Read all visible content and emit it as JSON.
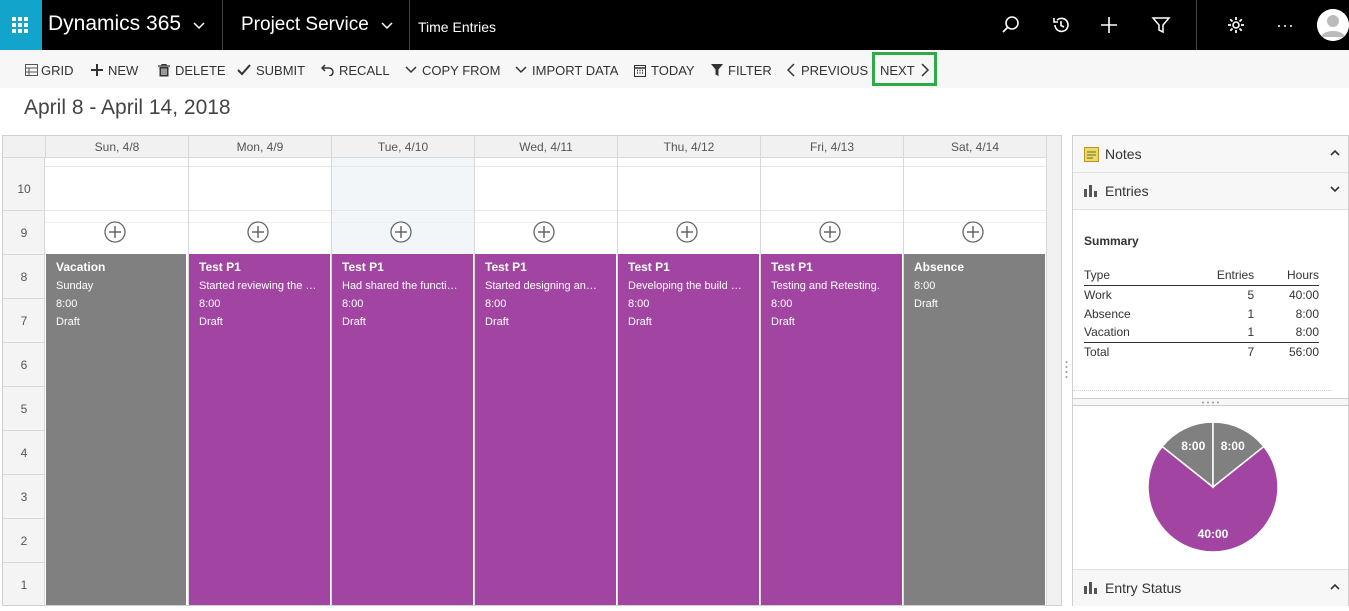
{
  "nav": {
    "brand": "Dynamics 365",
    "app": "Project Service",
    "area": "Time Entries"
  },
  "toolbar": {
    "grid": "GRID",
    "new": "NEW",
    "delete": "DELETE",
    "submit": "SUBMIT",
    "recall": "RECALL",
    "copy_from": "COPY FROM",
    "import_data": "IMPORT DATA",
    "today": "TODAY",
    "filter": "FILTER",
    "previous": "PREVIOUS",
    "next": "NEXT"
  },
  "date_range": "April 8 - April 14, 2018",
  "calendar": {
    "days": [
      "Sun, 4/8",
      "Mon, 4/9",
      "Tue, 4/10",
      "Wed, 4/11",
      "Thu, 4/12",
      "Fri, 4/13",
      "Sat, 4/14"
    ],
    "hours": [
      "10",
      "9",
      "8",
      "7",
      "6",
      "5",
      "4",
      "3",
      "2",
      "1"
    ],
    "entries": [
      {
        "title": "Vacation",
        "lines": [
          "Sunday",
          "8:00",
          "Draft"
        ],
        "color": "#808080"
      },
      {
        "title": "Test P1",
        "lines": [
          "Started reviewing the …",
          "8:00",
          "Draft"
        ],
        "color": "#a245a2"
      },
      {
        "title": "Test P1",
        "lines": [
          "Had shared the functi…",
          "8:00",
          "Draft"
        ],
        "color": "#a245a2"
      },
      {
        "title": "Test P1",
        "lines": [
          "Started designing an…",
          "8:00",
          "Draft"
        ],
        "color": "#a245a2"
      },
      {
        "title": "Test P1",
        "lines": [
          "Developing the build …",
          "8:00",
          "Draft"
        ],
        "color": "#a245a2"
      },
      {
        "title": "Test P1",
        "lines": [
          "Testing and Retesting.",
          "8:00",
          "Draft"
        ],
        "color": "#a245a2"
      },
      {
        "title": "Absence",
        "lines": [
          "8:00",
          "Draft"
        ],
        "color": "#808080"
      }
    ]
  },
  "panel": {
    "notes_label": "Notes",
    "entries_label": "Entries",
    "summary_title": "Summary",
    "headers": {
      "type": "Type",
      "entries": "Entries",
      "hours": "Hours"
    },
    "rows": [
      {
        "type": "Work",
        "entries": "5",
        "hours": "40:00"
      },
      {
        "type": "Absence",
        "entries": "1",
        "hours": "8:00"
      },
      {
        "type": "Vacation",
        "entries": "1",
        "hours": "8:00"
      }
    ],
    "total": {
      "type": "Total",
      "entries": "7",
      "hours": "56:00"
    },
    "entry_status_label": "Entry Status"
  },
  "chart_data": {
    "type": "pie",
    "slices": [
      {
        "label": "40:00",
        "value": 40,
        "color": "#a245a2"
      },
      {
        "label": "8:00",
        "value": 8,
        "color": "#808080"
      },
      {
        "label": "8:00",
        "value": 8,
        "color": "#808080"
      }
    ]
  }
}
